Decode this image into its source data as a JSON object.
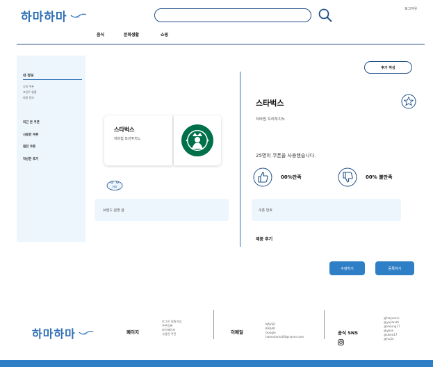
{
  "header": {
    "logo_text": "하마하마",
    "login_link": "로그아웃",
    "search": {
      "value": "",
      "placeholder": ""
    },
    "nav": [
      "음식",
      "문화생활",
      "쇼핑"
    ]
  },
  "sidebar": {
    "title": "내 정보",
    "sub_items": [
      "나의 쿠폰",
      "포인트 현황",
      "회원 정보"
    ],
    "items": [
      "최근 본 쿠폰",
      "사용한 쿠폰",
      "찜한 쿠폰",
      "작성한 후기"
    ]
  },
  "coupon": {
    "brand": "스타벅스",
    "product": "자바칩 프라푸치노",
    "mascot_label": "하마",
    "brand_description": "브랜드 설명 글"
  },
  "detail": {
    "review_write_button": "후기 작성",
    "brand": "스타벅스",
    "product": "자바칩 프라푸치노",
    "usage_text": "25명이 쿠폰을 사용했습니다.",
    "satisfied": "00%만족",
    "unsatisfied": "00% 불만족",
    "coupon_number_label": "쿠폰 번호",
    "product_review_label": "제품 후기",
    "edit_button": "수정하기",
    "register_button": "등록하기"
  },
  "footer": {
    "logo_text": "하마하마",
    "page_heading": "페이지",
    "page_links": [
      "로그인 회원가입",
      "쿠폰등록",
      "마이페이지",
      "사용한 쿠폰"
    ],
    "email_heading": "이메일",
    "email_links": [
      "NAVER",
      "KAKAO",
      "Google",
      "hamahama04@naver.com"
    ],
    "sns_heading": "공식 SNS",
    "sns_accounts": [
      "@hayunnn",
      "@yujinnah",
      "@leeung17",
      "@yeon",
      "@ukeo17",
      "@hujin"
    ]
  },
  "colors": {
    "brand_blue": "#2f6fb5",
    "button_blue": "#2f7fc7",
    "panel_bg": "#edf5fd",
    "starbucks_green": "#00704a"
  }
}
